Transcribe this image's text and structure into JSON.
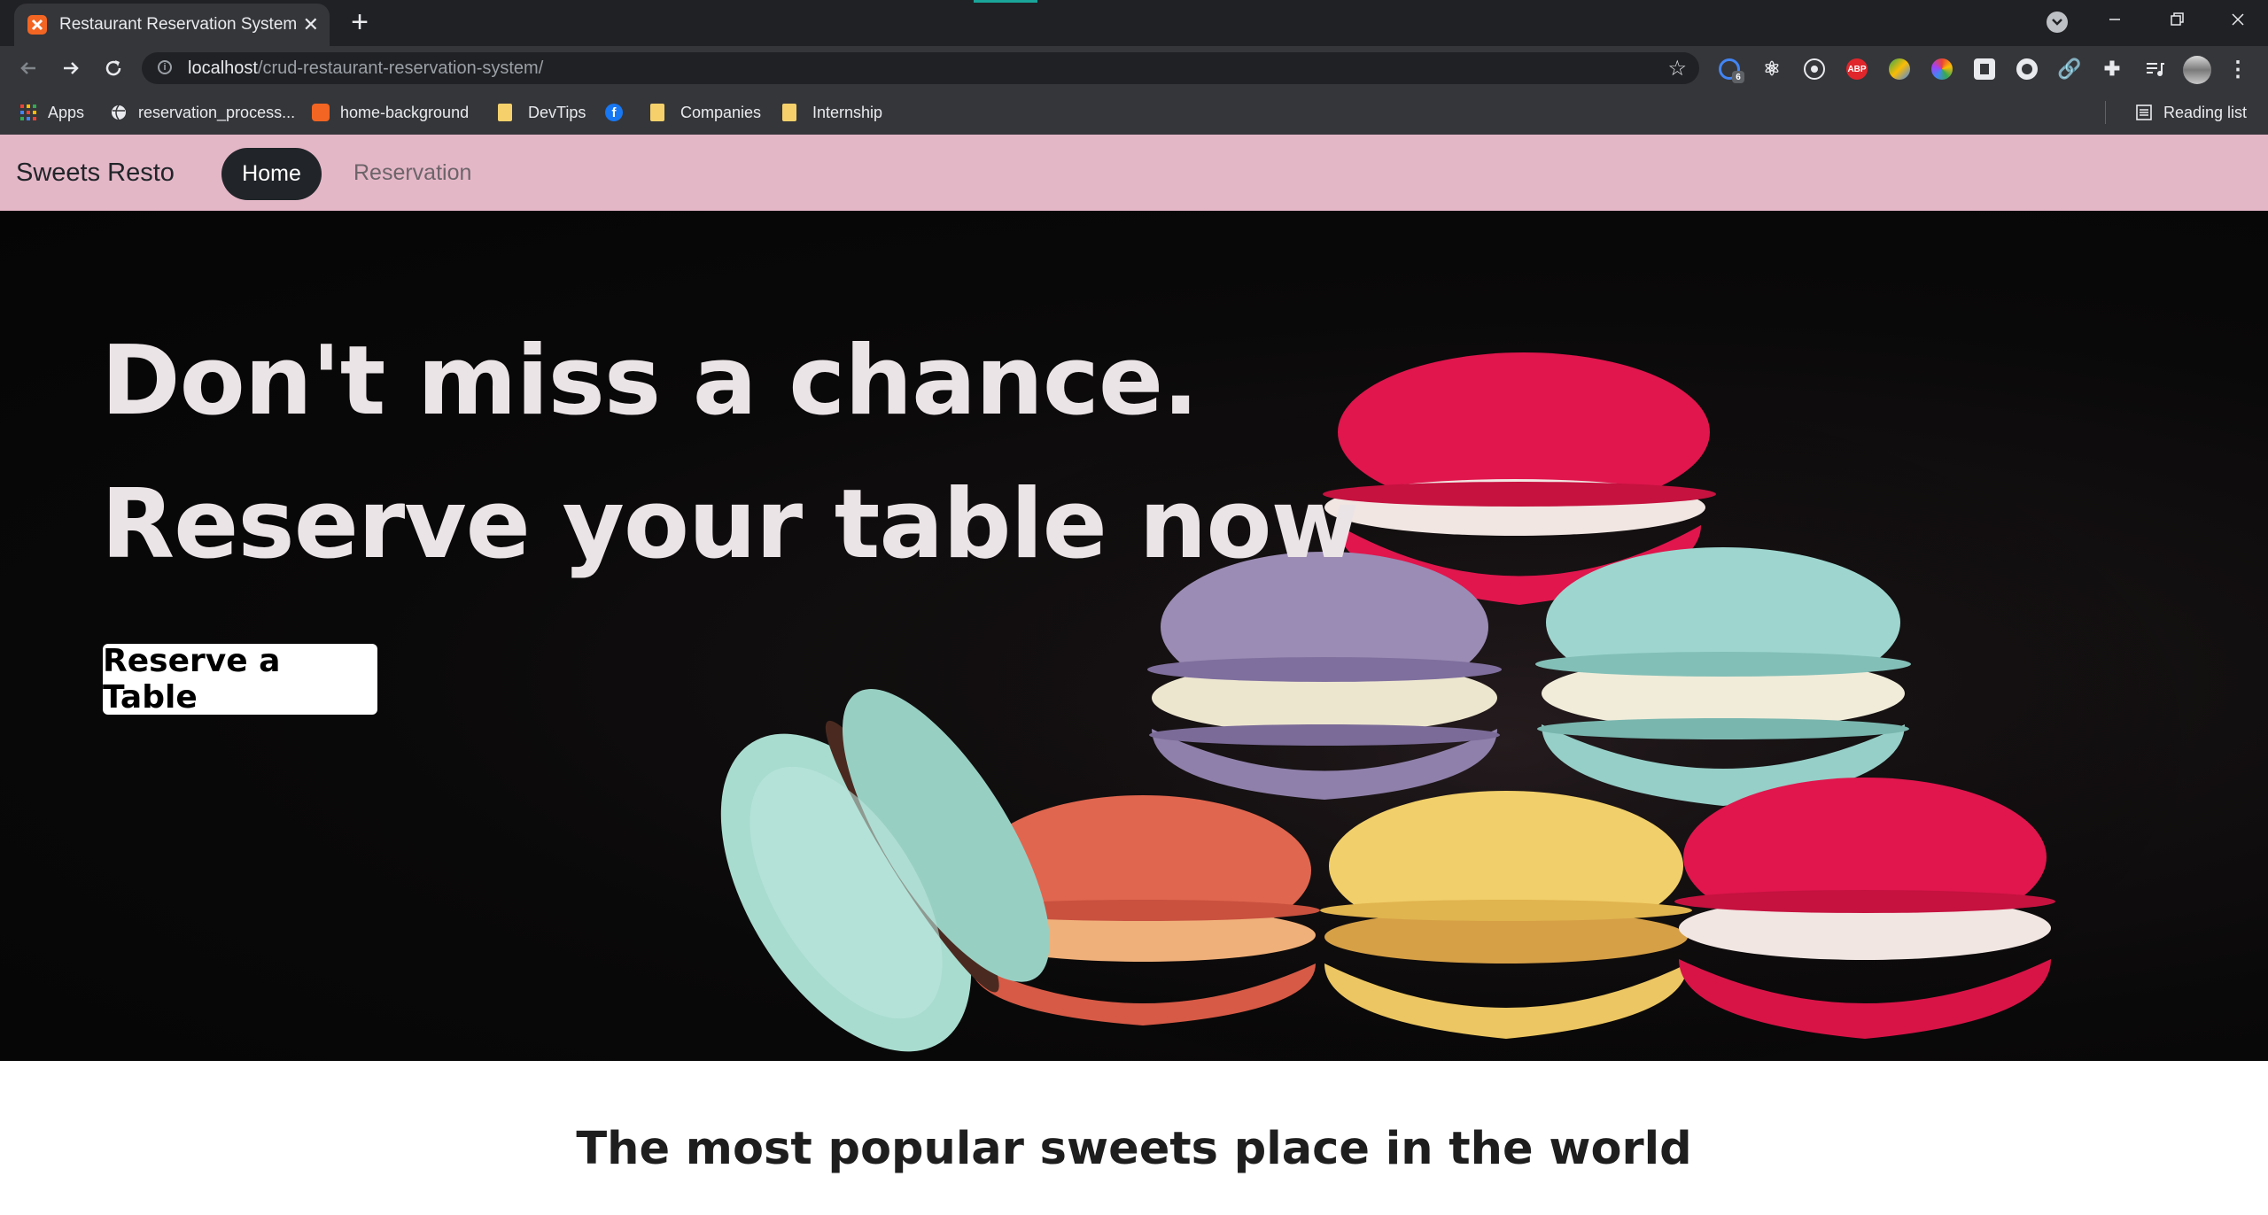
{
  "browser": {
    "tab_title": "Restaurant Reservation System",
    "new_tab": "+",
    "close_glyph": "✕",
    "url_host": "localhost",
    "url_path": "/crud-restaurant-reservation-system/",
    "extension_badge": "6",
    "abp_label": "ABP",
    "bookmarks": [
      {
        "label": "Apps",
        "icon": "apps-grid-icon"
      },
      {
        "label": "reservation_process...",
        "icon": "globe-icon"
      },
      {
        "label": "home-background",
        "icon": "xampp-icon"
      },
      {
        "label": "DevTips",
        "icon": "folder-icon"
      },
      {
        "label": "",
        "icon": "facebook-icon"
      },
      {
        "label": "Companies",
        "icon": "folder-icon"
      },
      {
        "label": "Internship",
        "icon": "folder-icon"
      }
    ],
    "reading_list": "Reading list"
  },
  "page": {
    "brand": "Sweets Resto",
    "nav": {
      "home": "Home",
      "reservation": "Reservation"
    },
    "hero": {
      "line1": "Don't miss a chance.",
      "line2": "Reserve your table now",
      "cta": "Reserve a Table"
    },
    "section_title": "The most popular sweets place in the world"
  },
  "colors": {
    "navbar_bg": "#e4b7c7",
    "hero_text": "#ebe4e6",
    "active_nav_bg": "#212529",
    "chrome_dark": "#202124",
    "chrome_toolbar": "#35363a"
  }
}
